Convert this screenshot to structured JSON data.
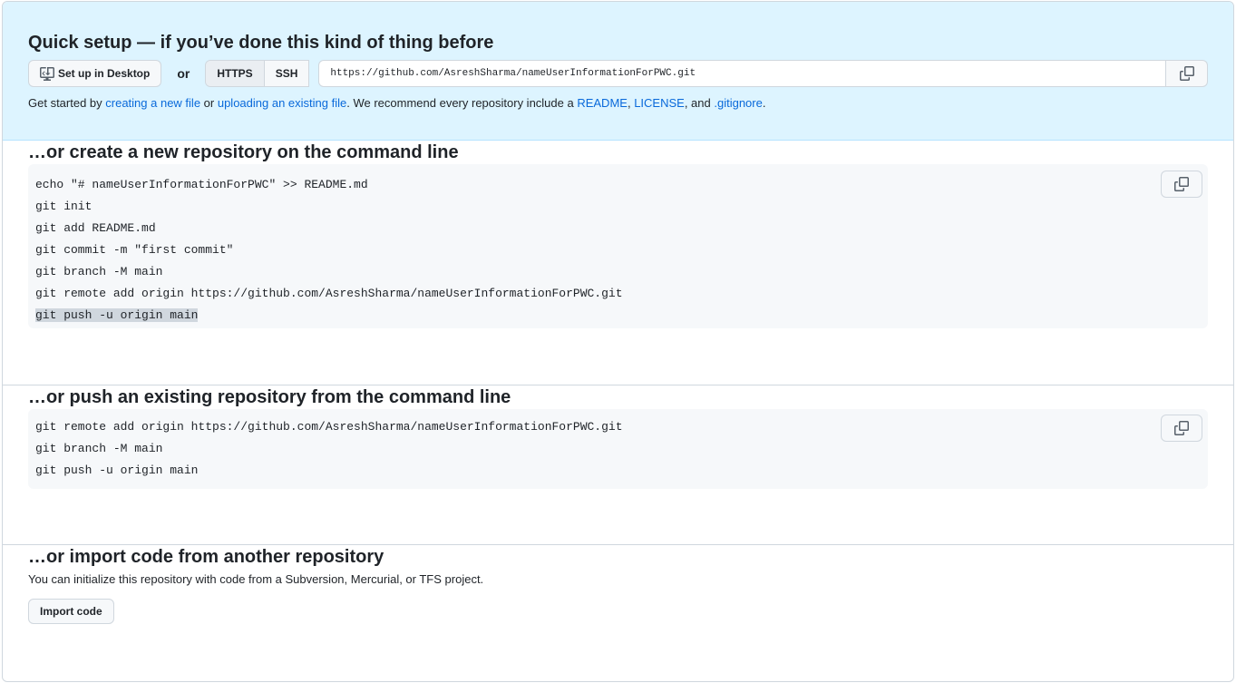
{
  "quick_setup": {
    "title": "Quick setup — if you’ve done this kind of thing before",
    "desktop_button": "Set up in Desktop",
    "or": "or",
    "protocols": [
      "HTTPS",
      "SSH"
    ],
    "url": "https://github.com/AsreshSharma/nameUserInformationForPWC.git",
    "help": {
      "t1": "Get started by ",
      "l1": "creating a new file",
      "t2": " or ",
      "l2": "uploading an existing file",
      "t3": ". We recommend every repository include a ",
      "l3": "README",
      "t4": ", ",
      "l4": "LICENSE",
      "t5": ", and ",
      "l5": ".gitignore",
      "t6": "."
    }
  },
  "create_new": {
    "title": "…or create a new repository on the command line",
    "lines": [
      "echo \"# nameUserInformationForPWC\" >> README.md",
      "git init",
      "git add README.md",
      "git commit -m \"first commit\"",
      "git branch -M main",
      "git remote add origin https://github.com/AsreshSharma/nameUserInformationForPWC.git",
      "git push -u origin main"
    ]
  },
  "push_existing": {
    "title": "…or push an existing repository from the command line",
    "lines": [
      "git remote add origin https://github.com/AsreshSharma/nameUserInformationForPWC.git",
      "git branch -M main",
      "git push -u origin main"
    ]
  },
  "import": {
    "title": "…or import code from another repository",
    "description": "You can initialize this repository with code from a Subversion, Mercurial, or TFS project.",
    "button": "Import code"
  },
  "icons": {
    "desktop": "desktop-download-icon",
    "copy": "copy-icon"
  },
  "colors": {
    "quick_bg": "#ddf4ff",
    "link": "#0969da",
    "code_bg": "#f6f8fa",
    "highlight": "#d0d7de"
  }
}
